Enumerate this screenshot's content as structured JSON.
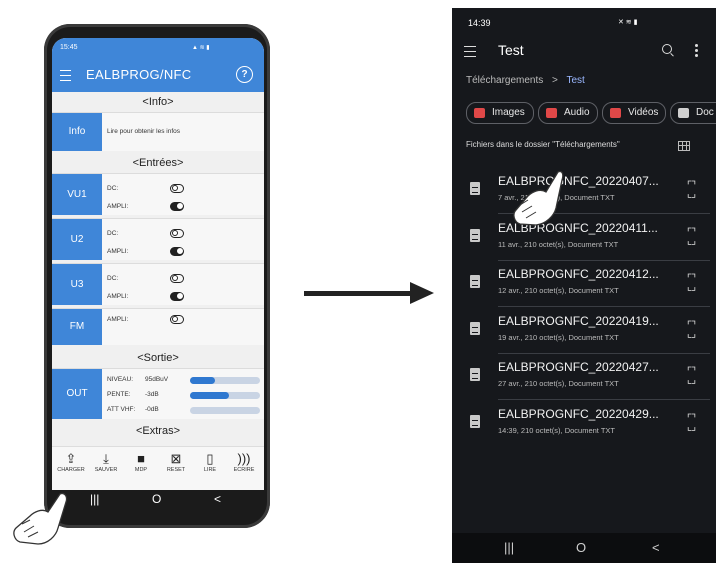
{
  "left_phone": {
    "status_time": "15:45",
    "app_title": "EALBPROG/NFC",
    "help_symbol": "?",
    "sections": {
      "info": "<Info>",
      "entrees": "<Entrées>",
      "sortie": "<Sortie>",
      "extras": "<Extras>"
    },
    "info_row": {
      "tag": "Info",
      "text": "Lire pour obtenir les infos"
    },
    "inputs": [
      {
        "tag": "VU1",
        "dc_label": "DC:",
        "ampli_label": "AMPLI:"
      },
      {
        "tag": "U2",
        "dc_label": "DC:",
        "ampli_label": "AMPLI:"
      },
      {
        "tag": "U3",
        "dc_label": "DC:",
        "ampli_label": "AMPLI:"
      },
      {
        "tag": "FM",
        "ampli_label": "AMPLI:"
      }
    ],
    "out": {
      "tag": "OUT",
      "niveau_label": "NIVEAU:",
      "niveau_value": "95dBuV",
      "niveau_fill": 0.35,
      "pente_label": "PENTE:",
      "pente_value": "-3dB",
      "pente_fill": 0.55,
      "attvhf_label": "ATT VHF:",
      "attvhf_value": "-0dB",
      "attvhf_fill": 0.0
    },
    "toolbar": {
      "charger": "CHARGER",
      "sauver": "SAUVER",
      "mdp": "MDP",
      "reset": "RESET",
      "lire": "LIRE",
      "ecrire": "ECRIRE"
    },
    "nav": {
      "recent": "|||",
      "home": "O",
      "back": "<"
    }
  },
  "right_phone": {
    "status_time": "14:39",
    "title": "Test",
    "breadcrumb": {
      "parent": "Téléchargements",
      "separator": ">",
      "current": "Test"
    },
    "chips": [
      {
        "label": "Images",
        "color": "#e04848"
      },
      {
        "label": "Audio",
        "color": "#e04848"
      },
      {
        "label": "Vidéos",
        "color": "#e04848"
      },
      {
        "label": "Doc",
        "color": "#e04848"
      }
    ],
    "folder_label": "Fichiers dans le dossier \"Téléchargements\"",
    "files": [
      {
        "name": "EALBPROGNFC_20220407...",
        "meta": "7 avr., 210 octet(s), Document TXT"
      },
      {
        "name": "EALBPROGNFC_20220411...",
        "meta": "11 avr., 210 octet(s), Document TXT"
      },
      {
        "name": "EALBPROGNFC_20220412...",
        "meta": "12 avr., 210 octet(s), Document TXT"
      },
      {
        "name": "EALBPROGNFC_20220419...",
        "meta": "19 avr., 210 octet(s), Document TXT"
      },
      {
        "name": "EALBPROGNFC_20220427...",
        "meta": "27 avr., 210 octet(s), Document TXT"
      },
      {
        "name": "EALBPROGNFC_20220429...",
        "meta": "14:39, 210 octet(s), Document TXT"
      }
    ],
    "nav": {
      "recent": "|||",
      "home": "O",
      "back": "<"
    }
  }
}
